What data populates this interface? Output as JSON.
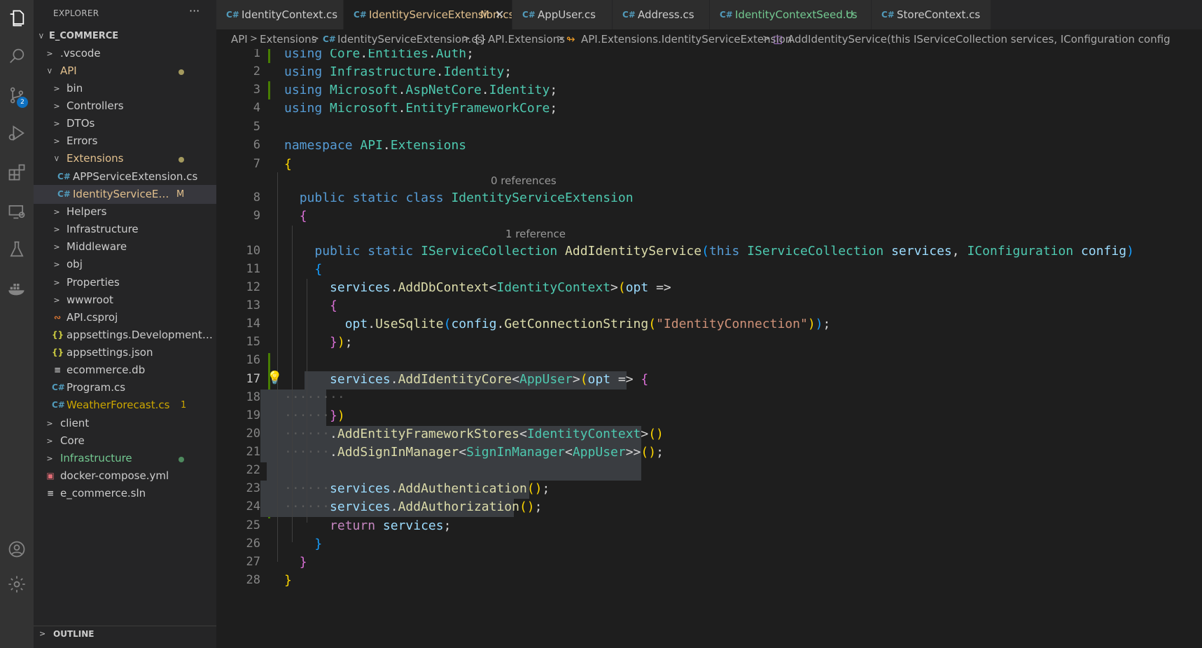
{
  "activity_bar": {
    "icons": [
      "explorer-icon",
      "search-icon",
      "source-control-icon",
      "run-debug-icon",
      "extensions-icon",
      "remote-explorer-icon",
      "testing-icon",
      "docker-icon",
      "accounts-icon",
      "settings-gear-icon"
    ],
    "source_control_badge": "2"
  },
  "sidebar": {
    "title": "EXPLORER",
    "more": "···",
    "root": "E_COMMERCE",
    "items": [
      {
        "label": ".vscode"
      },
      {
        "label": "API"
      },
      {
        "label": "bin"
      },
      {
        "label": "Controllers"
      },
      {
        "label": "DTOs"
      },
      {
        "label": "Errors"
      },
      {
        "label": "Extensions"
      },
      {
        "label": "APPServiceExtension.cs"
      },
      {
        "label": "IdentityServiceExte...",
        "decoration": "M"
      },
      {
        "label": "Helpers"
      },
      {
        "label": "Infrastructure"
      },
      {
        "label": "Middleware"
      },
      {
        "label": "obj"
      },
      {
        "label": "Properties"
      },
      {
        "label": "wwwroot"
      },
      {
        "label": "API.csproj"
      },
      {
        "label": "appsettings.Development.j..."
      },
      {
        "label": "appsettings.json"
      },
      {
        "label": "ecommerce.db"
      },
      {
        "label": "Program.cs"
      },
      {
        "label": "WeatherForecast.cs",
        "decoration": "1"
      },
      {
        "label": "client"
      },
      {
        "label": "Core"
      },
      {
        "label": "Infrastructure"
      },
      {
        "label": "docker-compose.yml"
      },
      {
        "label": "e_commerce.sln"
      }
    ],
    "outline": "OUTLINE"
  },
  "tabs": [
    {
      "label": "IdentityContext.cs",
      "decoration": ""
    },
    {
      "label": "IdentityServiceExtension.cs",
      "decoration": "M"
    },
    {
      "label": "AppUser.cs",
      "decoration": ""
    },
    {
      "label": "Address.cs",
      "decoration": ""
    },
    {
      "label": "IdentityContextSeed.cs",
      "decoration": "U"
    },
    {
      "label": "StoreContext.cs",
      "decoration": ""
    }
  ],
  "breadcrumb": [
    "API",
    "Extensions",
    "IdentityServiceExtension.cs",
    "API.Extensions",
    "API.Extensions.IdentityServiceExtension",
    "AddIdentityService(this IServiceCollection services, IConfiguration config"
  ],
  "editor": {
    "codelens": [
      "0 references",
      "1 reference"
    ],
    "line_numbers": [
      "1",
      "2",
      "3",
      "4",
      "5",
      "6",
      "7",
      "8",
      "9",
      "10",
      "11",
      "12",
      "13",
      "14",
      "15",
      "16",
      "17",
      "18",
      "19",
      "20",
      "21",
      "22",
      "23",
      "24",
      "25",
      "26",
      "27",
      "28"
    ],
    "current_line": "17"
  },
  "colors": {
    "activity_bar": "#333333",
    "sidebar": "#252526",
    "editor_bg": "#1e1e1e",
    "modified": "#e2c08d",
    "untracked": "#73c991",
    "git_gutter": "#487e02"
  }
}
